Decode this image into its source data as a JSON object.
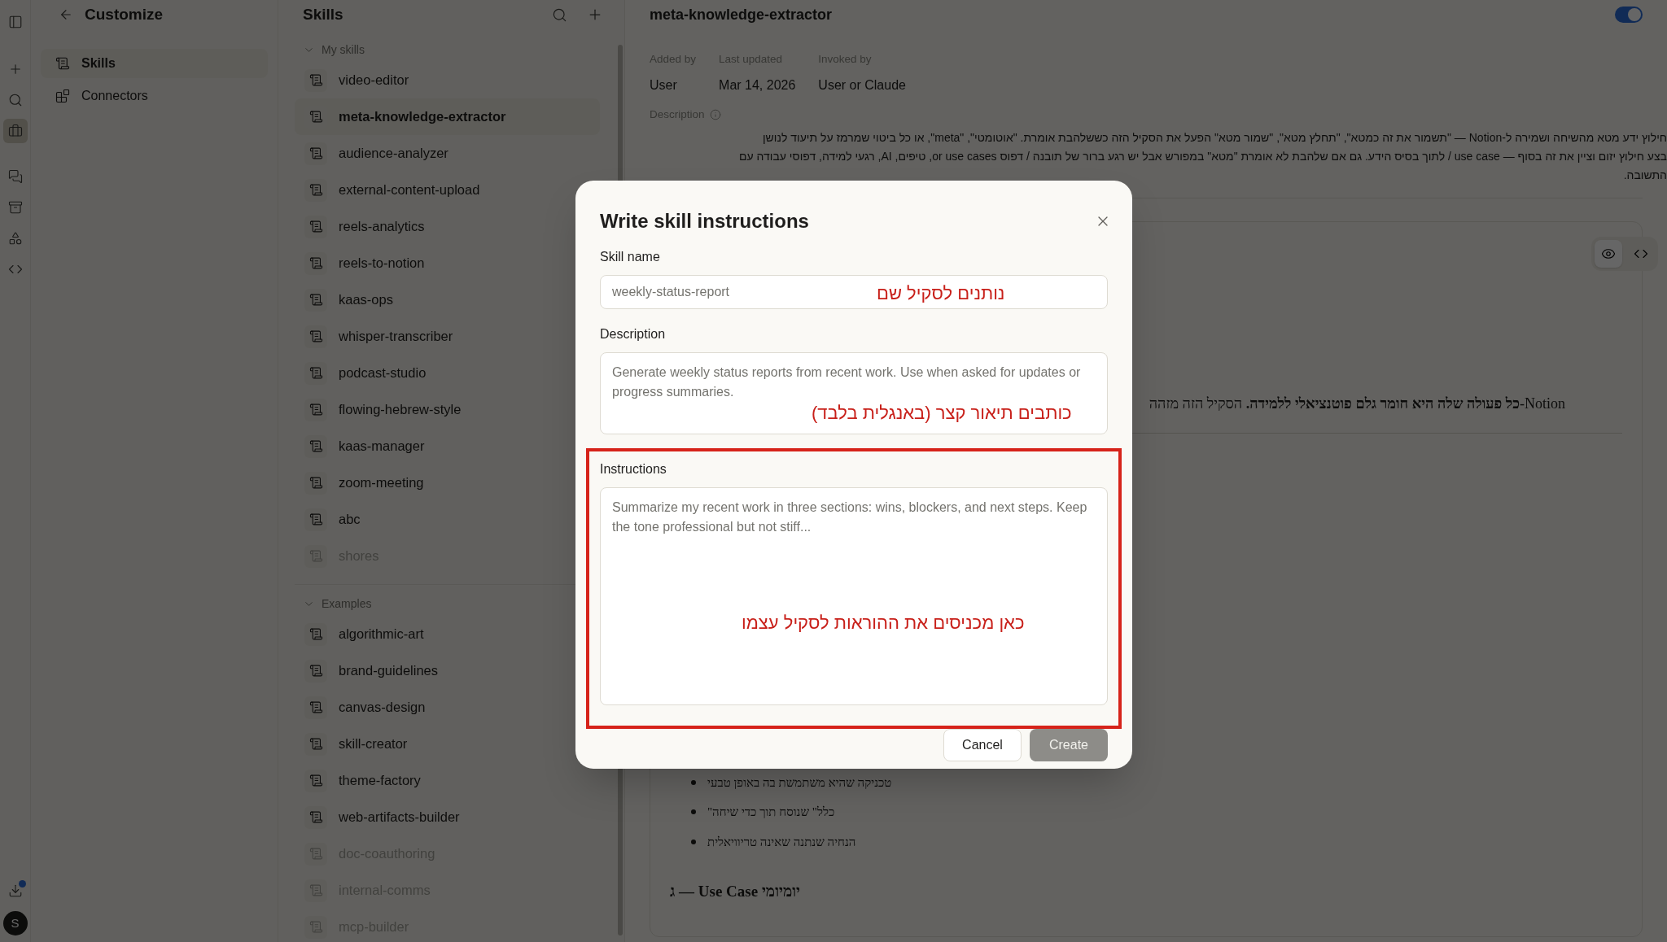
{
  "rail": {
    "items": [
      {
        "kind": "sidebar",
        "selected": false
      },
      {
        "kind": "new",
        "selected": false
      },
      {
        "kind": "search",
        "selected": false
      },
      {
        "kind": "customize",
        "selected": true
      },
      {
        "kind": "chats",
        "selected": false
      },
      {
        "kind": "projects",
        "selected": false
      },
      {
        "kind": "artifacts",
        "selected": false
      },
      {
        "kind": "code",
        "selected": false
      }
    ],
    "download_badge": true,
    "avatar": "S"
  },
  "customize": {
    "title": "Customize",
    "items": [
      {
        "label": "Skills",
        "kind": "skills",
        "selected": true
      },
      {
        "label": "Connectors",
        "kind": "connectors",
        "selected": false
      }
    ]
  },
  "skills_panel": {
    "title": "Skills",
    "sections": [
      {
        "title": "My skills",
        "expanded": true,
        "items": [
          {
            "label": "video-editor",
            "selected": false,
            "disabled": false
          },
          {
            "label": "meta-knowledge-extractor",
            "selected": true,
            "disabled": false
          },
          {
            "label": "audience-analyzer",
            "selected": false,
            "disabled": false
          },
          {
            "label": "external-content-upload",
            "selected": false,
            "disabled": false
          },
          {
            "label": "reels-analytics",
            "selected": false,
            "disabled": false
          },
          {
            "label": "reels-to-notion",
            "selected": false,
            "disabled": false
          },
          {
            "label": "kaas-ops",
            "selected": false,
            "disabled": false
          },
          {
            "label": "whisper-transcriber",
            "selected": false,
            "disabled": false
          },
          {
            "label": "podcast-studio",
            "selected": false,
            "disabled": false
          },
          {
            "label": "flowing-hebrew-style",
            "selected": false,
            "disabled": false
          },
          {
            "label": "kaas-manager",
            "selected": false,
            "disabled": false
          },
          {
            "label": "zoom-meeting",
            "selected": false,
            "disabled": false
          },
          {
            "label": "abc",
            "selected": false,
            "disabled": false
          },
          {
            "label": "shores",
            "selected": false,
            "disabled": true
          }
        ]
      },
      {
        "title": "Examples",
        "expanded": true,
        "items": [
          {
            "label": "algorithmic-art",
            "selected": false,
            "disabled": false
          },
          {
            "label": "brand-guidelines",
            "selected": false,
            "disabled": false
          },
          {
            "label": "canvas-design",
            "selected": false,
            "disabled": false
          },
          {
            "label": "skill-creator",
            "selected": false,
            "disabled": false
          },
          {
            "label": "theme-factory",
            "selected": false,
            "disabled": false
          },
          {
            "label": "web-artifacts-builder",
            "selected": false,
            "disabled": false
          },
          {
            "label": "doc-coauthoring",
            "selected": false,
            "disabled": true
          },
          {
            "label": "internal-comms",
            "selected": false,
            "disabled": true
          },
          {
            "label": "mcp-builder",
            "selected": false,
            "disabled": true
          }
        ]
      }
    ]
  },
  "skill": {
    "title": "meta-knowledge-extractor",
    "enabled": true,
    "meta": [
      {
        "label": "Added by",
        "value": "User"
      },
      {
        "label": "Last updated",
        "value": "Mar 14, 2026"
      },
      {
        "label": "Invoked by",
        "value": "User or Claude"
      }
    ],
    "description_label": "Description",
    "description": [
      "חילוץ ידע מטא מהשיחה ושמירה ל-Notion — \"תשמור את זה כמטא\", \"תחלץ מטא\", \"שמור מטא\" הפעל את הסקיל הזה כששלהבת אומרת. \"אוטומטי\", \"meta\", או כל ביטוי שמרמז על תיעוד לנושן",
      "בצע חילוץ יזום וציין את זה בסוף — use case / לתוך בסיס הידע. גם אם שלהבת לא אומרת \"מטא\" במפורש אבל יש רגע ברור של תובנה / דפוס or use cases, טיפים, AI, רגעי למידה, דפוסי עבודה עם",
      "התשובה."
    ],
    "view_modes": [
      {
        "kind": "preview",
        "selected": true
      },
      {
        "kind": "code",
        "selected": false
      }
    ],
    "paragraph": "Notion-**כל פעולה שלה היא חומר גלם פוטנציאלי ללמידה.** הסקיל הזה מזהה",
    "bullets": [
      "טכניקה שהיא משתמשת בה באופן טבעי",
      "כלל\" שנוסח תוך כדי שיחה\"",
      "הנחיה שנתנה שאינה טריוויאלית"
    ],
    "heading": "יומיומי Use Case — ג"
  },
  "dialog": {
    "title": "Write skill instructions",
    "fields": [
      {
        "kind": "input",
        "label": "Skill name",
        "placeholder": "weekly-status-report",
        "annotation": "נותנים לסקיל שם",
        "highlighted": false
      },
      {
        "kind": "textarea",
        "label": "Description",
        "placeholder": "Generate weekly status reports from recent work. Use when asked for updates or progress summaries.",
        "annotation": "כותבים תיאור קצר (באנגלית בלבד)",
        "highlighted": false
      },
      {
        "kind": "textarea",
        "label": "Instructions",
        "placeholder": "Summarize my recent work in three sections: wins, blockers, and next steps. Keep the tone professional but not stiff...",
        "annotation": "כאן מכניסים את ההוראות לסקיל עצמו",
        "highlighted": true
      }
    ],
    "buttons": [
      {
        "label": "Cancel",
        "kind": "secondary",
        "disabled": false
      },
      {
        "label": "Create",
        "kind": "primary",
        "disabled": true
      }
    ]
  }
}
